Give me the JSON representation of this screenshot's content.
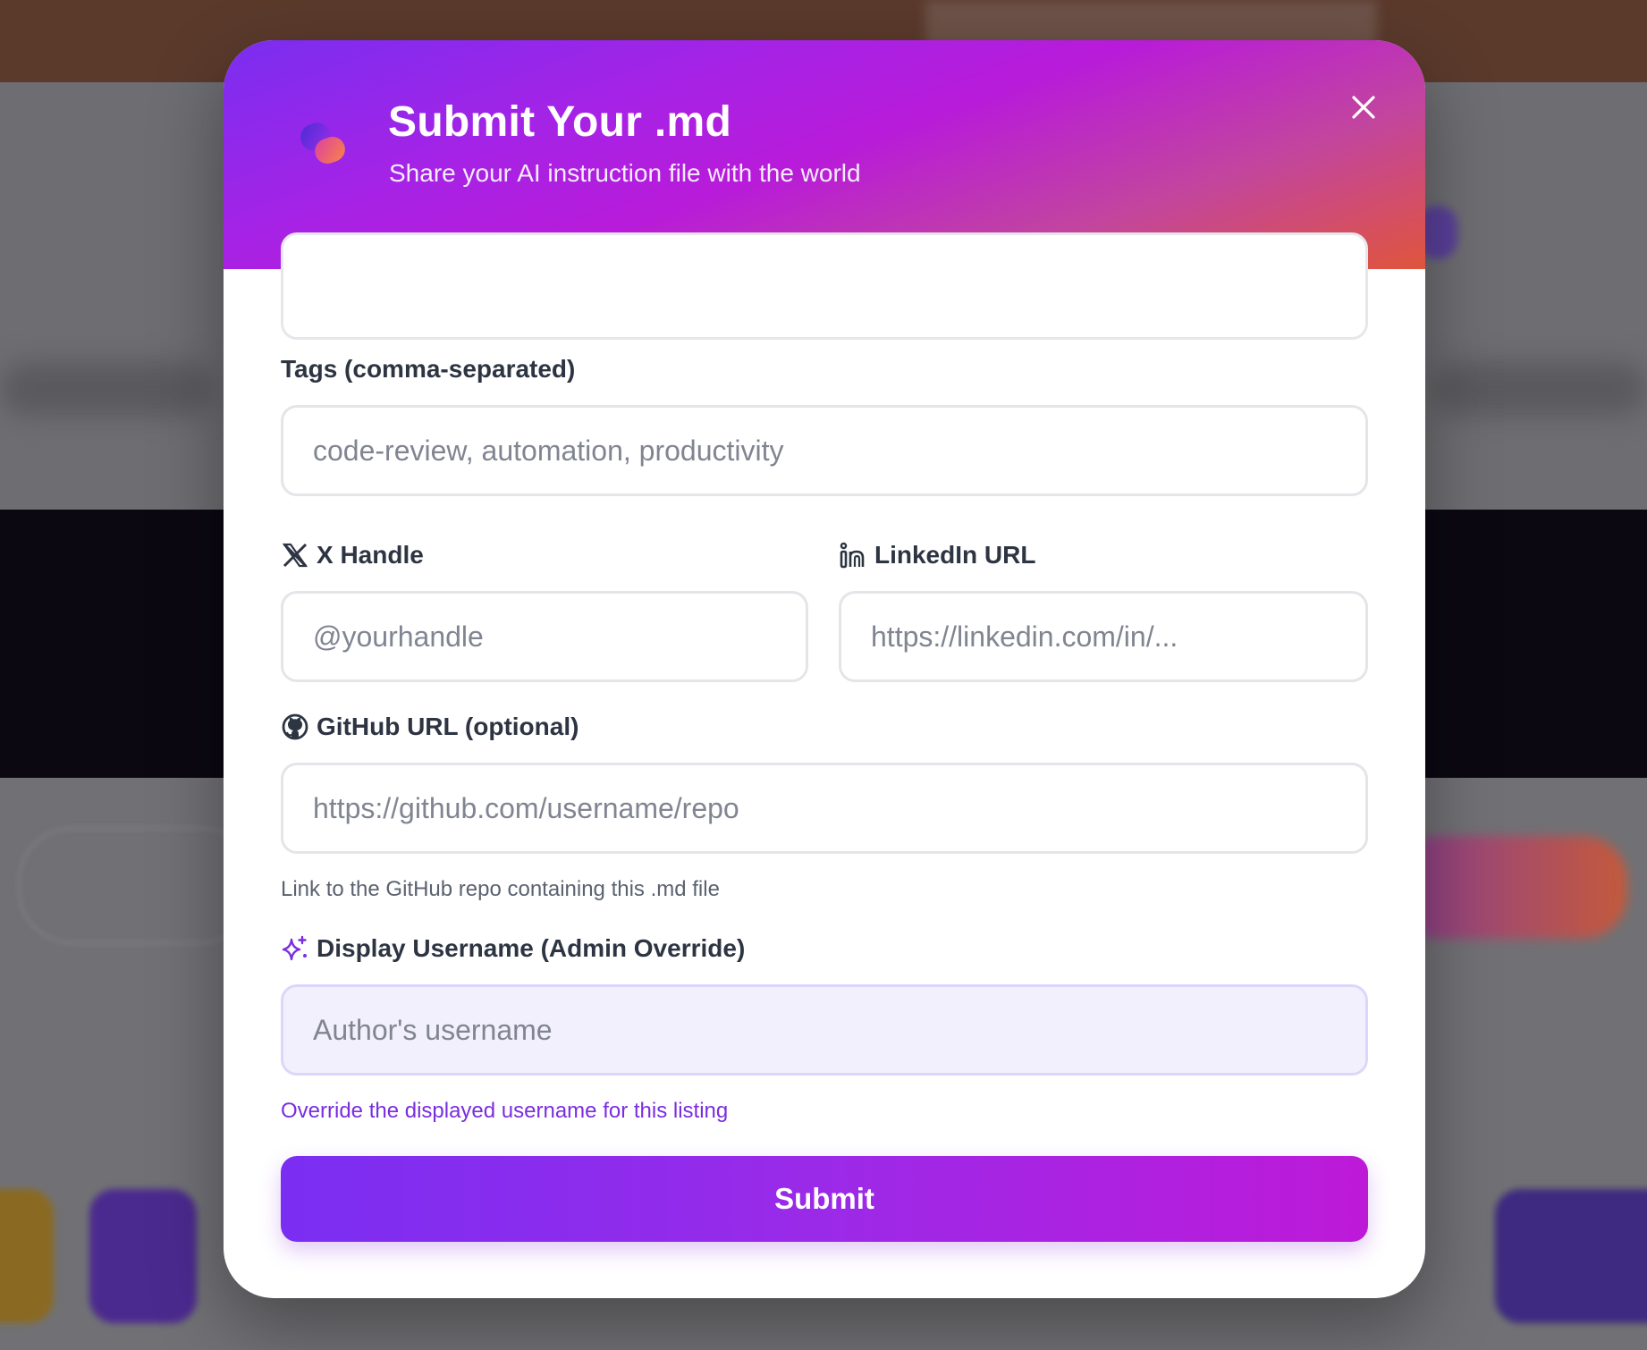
{
  "modal": {
    "title": "Submit Your .md",
    "subtitle": "Share your AI instruction file with the world",
    "close_icon": "close-icon",
    "logo_icon": "logo-icon"
  },
  "form": {
    "tags": {
      "label": "Tags (comma-separated)",
      "placeholder": "code-review, automation, productivity",
      "value": ""
    },
    "x_handle": {
      "label": "X Handle",
      "icon": "x-logo-icon",
      "placeholder": "@yourhandle",
      "value": ""
    },
    "linkedin": {
      "label": "LinkedIn URL",
      "icon": "linkedin-icon",
      "placeholder": "https://linkedin.com/in/...",
      "value": ""
    },
    "github": {
      "label": "GitHub URL (optional)",
      "icon": "github-icon",
      "placeholder": "https://github.com/username/repo",
      "value": "",
      "help": "Link to the GitHub repo containing this .md file"
    },
    "display_username": {
      "label": "Display Username (Admin Override)",
      "icon": "sparkles-icon",
      "placeholder": "Author's username",
      "value": "",
      "help": "Override the displayed username for this listing"
    },
    "submit_label": "Submit"
  },
  "colors": {
    "header_gradient": [
      "#7a2ef0",
      "#b81bd9",
      "#e0553c"
    ],
    "accent_purple": "#7a2de0",
    "submit_gradient": [
      "#7a2ef2",
      "#bd1ad8"
    ],
    "admin_field_bg": "#f3f0fd"
  }
}
